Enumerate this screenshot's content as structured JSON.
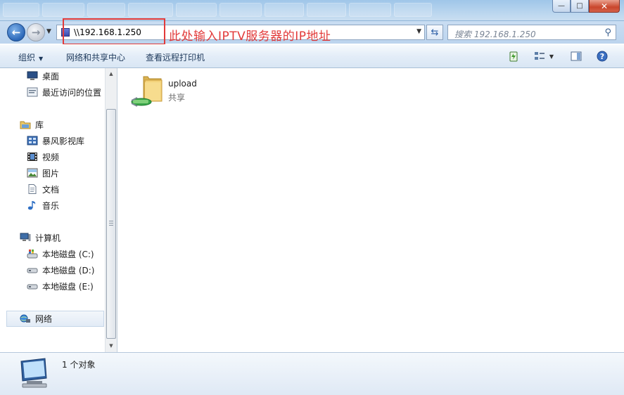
{
  "window": {
    "minimize_glyph": "—",
    "maximize_glyph": "□",
    "close_glyph": "✕"
  },
  "nav": {
    "back_glyph": "←",
    "forward_glyph": "→",
    "address_value": "\\\\192.168.1.250",
    "search_placeholder": "搜索 192.168.1.250"
  },
  "annotation": {
    "text": "此处输入IPTV服务器的IP地址",
    "color": "#e23a3a"
  },
  "toolbar": {
    "organize": "组织",
    "network_center": "网络和共享中心",
    "remote_printers": "查看远程打印机"
  },
  "sidebar": {
    "items": [
      {
        "label": "桌面",
        "icon": "desktop-icon"
      },
      {
        "label": "最近访问的位置",
        "icon": "recent-places-icon"
      },
      {
        "label": "库",
        "icon": "libraries-icon"
      },
      {
        "label": "暴风影视库",
        "icon": "video-library-icon"
      },
      {
        "label": "视频",
        "icon": "videos-icon"
      },
      {
        "label": "图片",
        "icon": "pictures-icon"
      },
      {
        "label": "文档",
        "icon": "documents-icon"
      },
      {
        "label": "音乐",
        "icon": "music-icon"
      },
      {
        "label": "计算机",
        "icon": "computer-icon"
      },
      {
        "label": "本地磁盘 (C:)",
        "icon": "system-drive-icon"
      },
      {
        "label": "本地磁盘 (D:)",
        "icon": "drive-icon"
      },
      {
        "label": "本地磁盘 (E:)",
        "icon": "drive-icon"
      },
      {
        "label": "网络",
        "icon": "network-icon"
      }
    ]
  },
  "content": {
    "items": [
      {
        "name": "upload",
        "subtitle": "共享",
        "icon": "shared-folder-icon"
      }
    ]
  },
  "details": {
    "text": "1 个对象",
    "icon": "network-computer-icon"
  },
  "colors": {
    "accent": "#2b67b8",
    "annotation_red": "#e23a3a"
  }
}
